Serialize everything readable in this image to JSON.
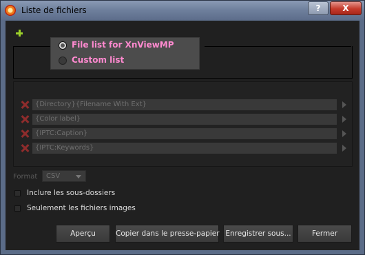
{
  "window": {
    "title": "Liste de fichiers",
    "help_label": "?",
    "close_label": "X"
  },
  "icons": {
    "app": "xnview-logo-icon",
    "add": "plus-icon",
    "remove": "remove-x-icon",
    "expand": "triangle-right-icon"
  },
  "mode": {
    "options": [
      {
        "label": "File list for XnViewMP",
        "checked": true
      },
      {
        "label": "Custom list",
        "checked": false
      }
    ]
  },
  "fields": [
    {
      "value": "{Directory}{Filename With Ext}"
    },
    {
      "value": "{Color label}"
    },
    {
      "value": "{IPTC:Caption}"
    },
    {
      "value": "{IPTC:Keywords}"
    }
  ],
  "format": {
    "label": "Format",
    "value": "CSV"
  },
  "options": {
    "include_subfolders": {
      "label": "Inclure les sous-dossiers",
      "checked": false
    },
    "images_only": {
      "label": "Seulement les fichiers images",
      "checked": false
    }
  },
  "buttons": {
    "preview": "Aperçu",
    "copy": "Copier dans le presse-papier",
    "save": "Enregistrer sous...",
    "close": "Fermer"
  },
  "colors": {
    "accent_label": "#ff8ad0",
    "remove_icon": "#8e2c2c",
    "add_icon": "#9bd02a",
    "window_frame": "#5b6c88",
    "client_bg": "#202020"
  }
}
